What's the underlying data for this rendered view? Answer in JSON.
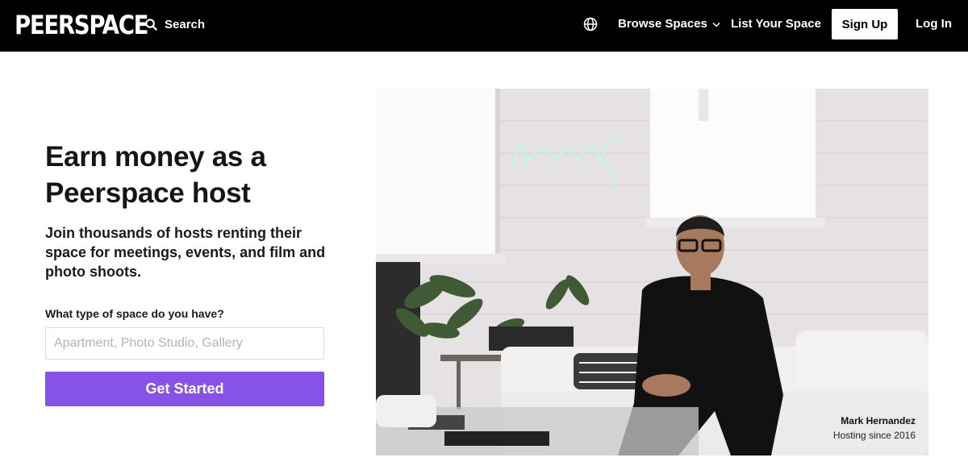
{
  "nav": {
    "logo": "PEERSPACE",
    "search_label": "Search",
    "browse_label": "Browse Spaces",
    "list_label": "List Your Space",
    "signup_label": "Sign Up",
    "login_label": "Log In",
    "icons": [
      "search-icon",
      "globe-icon",
      "chevron-down-icon"
    ]
  },
  "hero": {
    "headline": "Earn money as a Peerspace host",
    "subtext": "Join thousands of hosts renting their space for meetings, events, and film and photo shoots.",
    "field_label": "What type of space do you have?",
    "input_placeholder": "Apartment, Photo Studio, Gallery",
    "input_value": "",
    "cta_label": "Get Started"
  },
  "photo": {
    "caption_name": "Mark Hernandez",
    "caption_sub": "Hosting since 2016",
    "neon_sign": "Arensdy"
  },
  "colors": {
    "nav_bg": "#000000",
    "accent": "#8652e8",
    "text": "#151515"
  }
}
